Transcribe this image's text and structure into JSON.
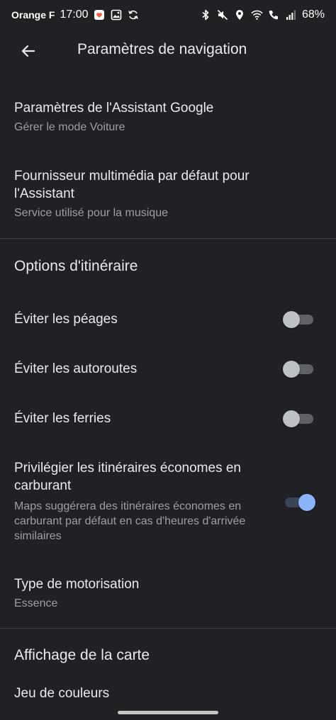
{
  "status_bar": {
    "carrier": "Orange F",
    "time": "17:00",
    "battery": "68%"
  },
  "app_bar": {
    "title": "Paramètres de navigation"
  },
  "assistant": {
    "title": "Paramètres de l'Assistant Google",
    "subtitle": "Gérer le mode Voiture"
  },
  "media_provider": {
    "title": "Fournisseur multimédia par défaut pour l'Assistant",
    "subtitle": "Service utilisé pour la musique"
  },
  "route_options": {
    "header": "Options d'itinéraire",
    "avoid_tolls": {
      "label": "Éviter les péages",
      "on": false
    },
    "avoid_highways": {
      "label": "Éviter les autoroutes",
      "on": false
    },
    "avoid_ferries": {
      "label": "Éviter les ferries",
      "on": false
    },
    "fuel_efficient": {
      "label": "Privilégier les itinéraires économes en carburant",
      "description": "Maps suggérera des itinéraires économes en carburant par défaut en cas d'heures d'arrivée similaires",
      "on": true
    },
    "engine_type": {
      "title": "Type de motorisation",
      "value": "Essence"
    }
  },
  "map_display": {
    "header": "Affichage de la carte",
    "color_scheme": "Jeu de couleurs"
  },
  "colors": {
    "background": "#202124",
    "switch_on": "#8ab4f8",
    "switch_off": "#bdc1c6"
  }
}
